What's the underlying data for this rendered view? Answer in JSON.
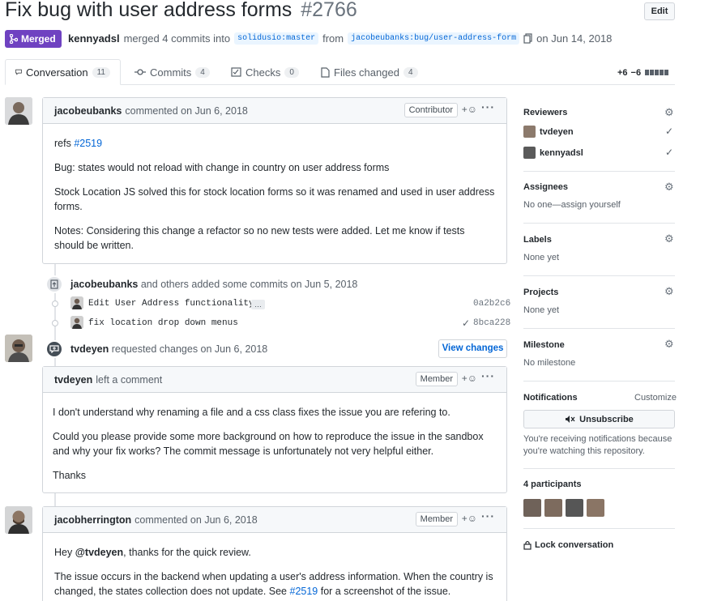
{
  "header": {
    "title": "Fix bug with user address forms",
    "number": "#2766",
    "edit_label": "Edit",
    "status": "Merged",
    "merger": "kennyadsl",
    "merge_text": "merged 4 commits into",
    "base_branch": "solidusio:master",
    "from_text": "from",
    "head_branch": "jacobeubanks:bug/user-address-form",
    "date": "on Jun 14, 2018"
  },
  "tabs": [
    {
      "label": "Conversation",
      "count": "11"
    },
    {
      "label": "Commits",
      "count": "4"
    },
    {
      "label": "Checks",
      "count": "0"
    },
    {
      "label": "Files changed",
      "count": "4"
    }
  ],
  "diffstat": {
    "additions": "+6",
    "deletions": "−6"
  },
  "comment1": {
    "author": "jacobeubanks",
    "meta": "commented on Jun 6, 2018",
    "role": "Contributor",
    "refs": "refs",
    "ref_link": "#2519",
    "p2": "Bug: states would not reload with change in country on user address forms",
    "p3": "Stock Location JS solved this for stock location forms so it was renamed and used in user address forms.",
    "p4": "Notes: Considering this change a refactor so no new tests were added. Let me know if tests should be written."
  },
  "commits_event": {
    "author": "jacobeubanks",
    "text": "and others added some commits on Jun 5, 2018",
    "commits": [
      {
        "message": "Edit User Address functionality",
        "ellipsis": "…",
        "sha": "0a2b2c6"
      },
      {
        "message": "fix location drop down menus",
        "sha": "8bca228"
      }
    ]
  },
  "review_event": {
    "author": "tvdeyen",
    "text": "requested changes on Jun 6, 2018",
    "button": "View changes"
  },
  "comment2": {
    "author": "tvdeyen",
    "meta": "left a comment",
    "role": "Member",
    "p1": "I don't understand why renaming a file and a css class fixes the issue you are refering to.",
    "p2": "Could you please provide some more background on how to reproduce the issue in the sandbox and why your fix works? The commit message is unfortunately not very helpful either.",
    "p3": "Thanks"
  },
  "comment3": {
    "author": "jacobherrington",
    "meta": "commented on Jun 6, 2018",
    "role": "Member",
    "p1_pre": "Hey",
    "p1_mention": "@tvdeyen",
    "p1_post": ", thanks for the quick review.",
    "p2_pre": "The issue occurs in the backend when updating a user's address information. When the country is changed, the states collection does not update. See",
    "p2_link": "#2519",
    "p2_post": "for a screenshot of the issue."
  },
  "sidebar": {
    "reviewers_label": "Reviewers",
    "reviewers": [
      "tvdeyen",
      "kennyadsl"
    ],
    "assignees_label": "Assignees",
    "assignees_value": "No one—assign yourself",
    "labels_label": "Labels",
    "labels_value": "None yet",
    "projects_label": "Projects",
    "projects_value": "None yet",
    "milestone_label": "Milestone",
    "milestone_value": "No milestone",
    "notifications_label": "Notifications",
    "customize_label": "Customize",
    "unsubscribe_label": "Unsubscribe",
    "notif_text": "You're receiving notifications because you're watching this repository.",
    "participants_label": "4 participants",
    "lock_label": "Lock conversation"
  },
  "colors": {
    "merged": "#6f42c1",
    "link": "#0366d6"
  }
}
